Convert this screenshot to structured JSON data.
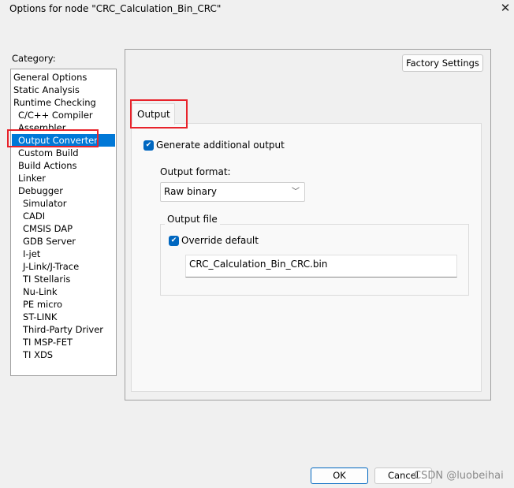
{
  "window": {
    "title": "Options for node \"CRC_Calculation_Bin_CRC\"",
    "close_icon": "close-icon"
  },
  "category": {
    "label": "Category:",
    "items": [
      {
        "label": "General Options",
        "level": 0
      },
      {
        "label": "Static Analysis",
        "level": 0
      },
      {
        "label": "Runtime Checking",
        "level": 0
      },
      {
        "label": "C/C++ Compiler",
        "level": 1
      },
      {
        "label": "Assembler",
        "level": 1
      },
      {
        "label": "Output Converter",
        "level": 1,
        "selected": true
      },
      {
        "label": "Custom Build",
        "level": 1
      },
      {
        "label": "Build Actions",
        "level": 1
      },
      {
        "label": "Linker",
        "level": 1
      },
      {
        "label": "Debugger",
        "level": 1
      },
      {
        "label": "Simulator",
        "level": 2
      },
      {
        "label": "CADI",
        "level": 2
      },
      {
        "label": "CMSIS DAP",
        "level": 2
      },
      {
        "label": "GDB Server",
        "level": 2
      },
      {
        "label": "I-jet",
        "level": 2
      },
      {
        "label": "J-Link/J-Trace",
        "level": 2
      },
      {
        "label": "TI Stellaris",
        "level": 2
      },
      {
        "label": "Nu-Link",
        "level": 2
      },
      {
        "label": "PE micro",
        "level": 2
      },
      {
        "label": "ST-LINK",
        "level": 2
      },
      {
        "label": "Third-Party Driver",
        "level": 2
      },
      {
        "label": "TI MSP-FET",
        "level": 2
      },
      {
        "label": "TI XDS",
        "level": 2
      }
    ]
  },
  "panel": {
    "factory_settings": "Factory Settings",
    "tab": "Output",
    "generate_output": {
      "label": "Generate additional output",
      "checked": true
    },
    "output_format": {
      "label": "Output format:",
      "value": "Raw binary"
    },
    "output_file": {
      "title": "Output file",
      "override": {
        "label": "Override default",
        "checked": true
      },
      "value": "CRC_Calculation_Bin_CRC.bin"
    }
  },
  "buttons": {
    "ok": "OK",
    "cancel": "Cancel"
  },
  "watermark": "CSDN @luobeihai",
  "colors": {
    "selection": "#0078d7",
    "highlight_box": "#e8232b",
    "checkbox": "#0067c0"
  }
}
